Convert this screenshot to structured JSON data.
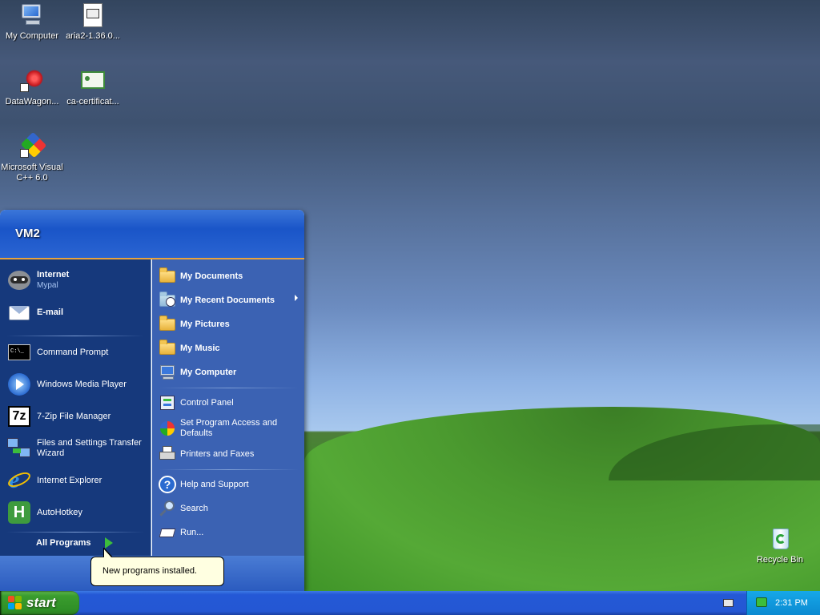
{
  "desktop": {
    "icons": [
      {
        "label": "My Computer"
      },
      {
        "label": "aria2-1.36.0..."
      },
      {
        "label": "DataWagon..."
      },
      {
        "label": "ca-certificat..."
      },
      {
        "label": "Microsoft Visual C++ 6.0"
      },
      {
        "label": "Recycle Bin"
      }
    ]
  },
  "start_menu": {
    "user_name": "VM2",
    "pinned": [
      {
        "title": "Internet",
        "subtitle": "Mypal"
      },
      {
        "title": "E-mail"
      }
    ],
    "recent": [
      {
        "label": "Command Prompt"
      },
      {
        "label": "Windows Media Player"
      },
      {
        "label": "7-Zip File Manager"
      },
      {
        "label": "Files and Settings Transfer Wizard"
      },
      {
        "label": "Internet Explorer"
      },
      {
        "label": "AutoHotkey"
      }
    ],
    "all_programs": "All Programs",
    "places": [
      {
        "label": "My Documents"
      },
      {
        "label": "My Recent Documents"
      },
      {
        "label": "My Pictures"
      },
      {
        "label": "My Music"
      },
      {
        "label": "My Computer"
      }
    ],
    "settings": [
      {
        "label": "Control Panel"
      },
      {
        "label": "Set Program Access and Defaults"
      },
      {
        "label": "Printers and Faxes"
      }
    ],
    "tools": [
      {
        "label": "Help and Support"
      },
      {
        "label": "Search"
      },
      {
        "label": "Run..."
      }
    ]
  },
  "tooltip": {
    "text": "New programs installed."
  },
  "taskbar": {
    "start_label": "start",
    "clock": "2:31 PM"
  }
}
